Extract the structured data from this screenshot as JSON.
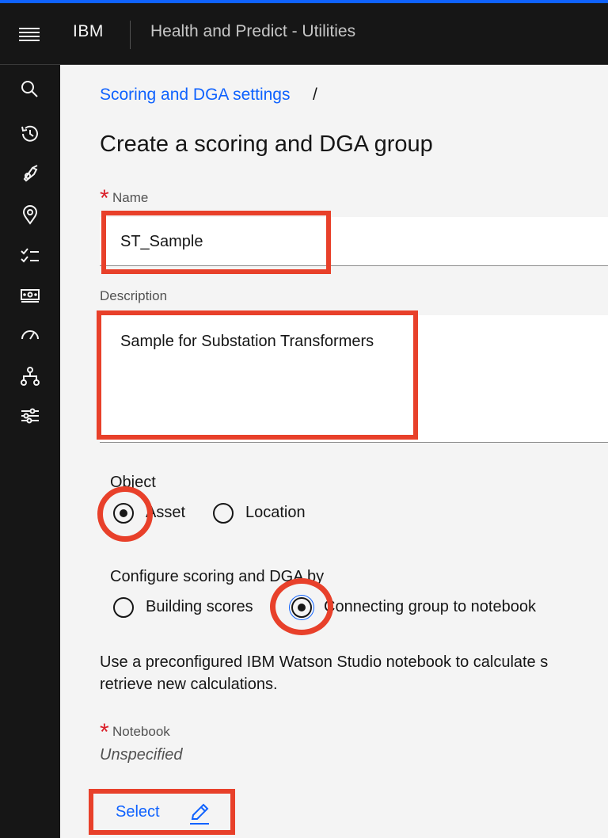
{
  "header": {
    "brand": "IBM",
    "app_title": "Health and Predict - Utilities",
    "menu_icon": "hamburger-menu-icon"
  },
  "rail": {
    "icons": [
      "search-icon",
      "recent-history-icon",
      "asset-tag-icon",
      "location-pin-icon",
      "checklist-icon",
      "money-icon",
      "gauge-icon",
      "hierarchy-icon",
      "settings-sliders-icon"
    ]
  },
  "breadcrumb": {
    "link": "Scoring and DGA settings",
    "separator": "/"
  },
  "page": {
    "title": "Create a scoring and DGA group"
  },
  "form": {
    "name_label": "Name",
    "name_value": "ST_Sample",
    "description_label": "Description",
    "description_value": "Sample for Substation Transformers",
    "required_marker": "*",
    "object_legend": "Object",
    "object_options": [
      {
        "label": "Asset",
        "selected": true
      },
      {
        "label": "Location",
        "selected": false
      }
    ],
    "configure_legend": "Configure scoring and DGA by",
    "configure_options": [
      {
        "label": "Building scores",
        "selected": false
      },
      {
        "label": "Connecting group to notebook",
        "selected": true
      }
    ],
    "help_line1": "Use a preconfigured IBM Watson Studio notebook to calculate s",
    "help_line2": "retrieve new calculations.",
    "notebook_label": "Notebook",
    "notebook_value": "Unspecified",
    "select_label": "Select",
    "select_icon": "edit-pencil-icon"
  },
  "colors": {
    "accent": "#0f62fe",
    "header_bg": "#161616",
    "page_bg": "#f4f4f4",
    "required": "#da1e28",
    "annotation": "#e8402a"
  }
}
